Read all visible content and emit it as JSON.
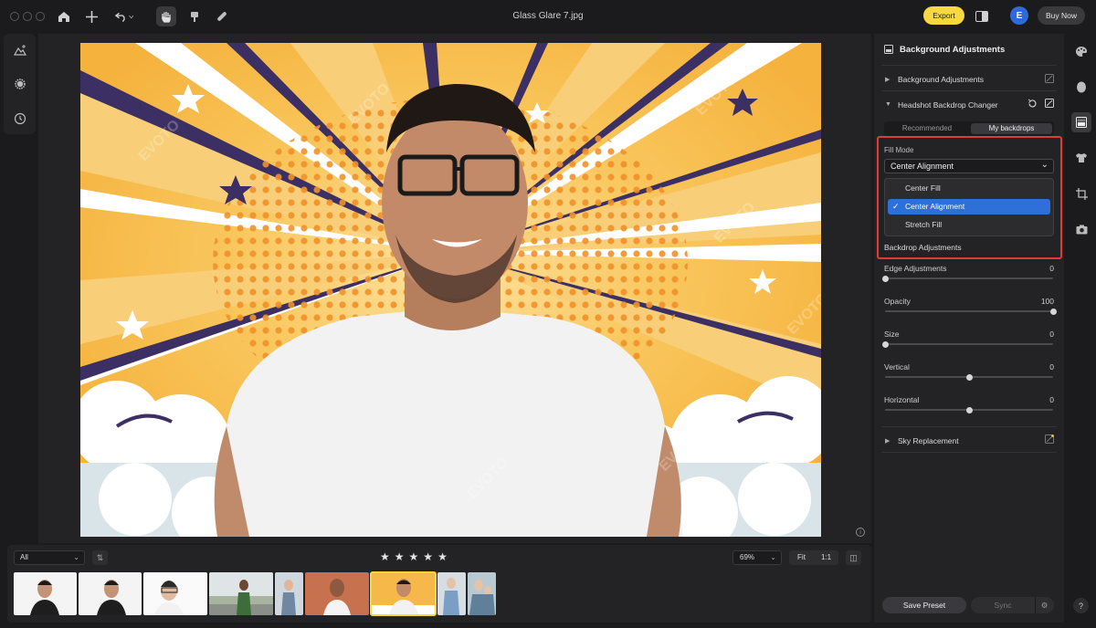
{
  "window": {
    "title": "Glass Glare 7.jpg"
  },
  "topbar": {
    "export_label": "Export",
    "avatar_letter": "E",
    "buy_label": "Buy Now"
  },
  "filmstrip": {
    "filter_value": "All",
    "zoom_value": "69%",
    "fit_label": "Fit",
    "one_to_one_label": "1:1",
    "rating_stars": 5
  },
  "panel": {
    "header": "Background Adjustments",
    "section_bg": "Background Adjustments",
    "section_headshot": "Headshot Backdrop Changer",
    "tab_recommended": "Recommended",
    "tab_my_backdrops": "My backdrops",
    "fill_mode_label": "Fill Mode",
    "fill_mode_value": "Center Alignment",
    "fill_options": [
      "Center Fill",
      "Center Alignment",
      "Stretch Fill"
    ],
    "backdrop_adjustments": "Backdrop Adjustments",
    "sliders": [
      {
        "label": "Edge Adjustments",
        "value": "0",
        "fraction": 0.0
      },
      {
        "label": "Opacity",
        "value": "100",
        "fraction": 1.0
      },
      {
        "label": "Size",
        "value": "0",
        "fraction": 0.0
      },
      {
        "label": "Vertical",
        "value": "0",
        "fraction": 0.5
      },
      {
        "label": "Horizontal",
        "value": "0",
        "fraction": 0.5
      }
    ],
    "sky_replacement": "Sky Replacement",
    "save_preset": "Save Preset",
    "sync": "Sync"
  },
  "colors": {
    "accent_yellow": "#f7d83f",
    "selection_blue": "#2e6fd9",
    "highlight_red": "#e03a3a"
  }
}
